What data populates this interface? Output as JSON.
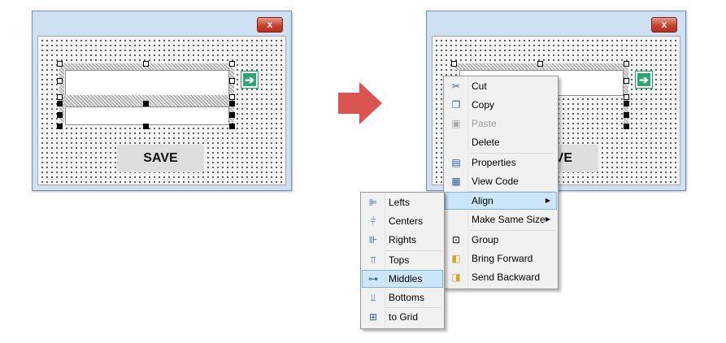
{
  "before": {
    "close_glyph": "x",
    "save_label": "SAVE"
  },
  "after": {
    "close_glyph": "x",
    "save_label_partial": "VE"
  },
  "arrow_color": "#d95550",
  "context_menu": {
    "items": [
      {
        "label": "Cut",
        "icon": "scissors-icon",
        "glyph": "✂"
      },
      {
        "label": "Copy",
        "icon": "copy-icon",
        "glyph": "❐"
      },
      {
        "label": "Paste",
        "icon": "paste-icon",
        "glyph": "▣",
        "disabled": true
      },
      {
        "label": "Delete",
        "icon": ""
      },
      {
        "label": "Properties",
        "icon": "properties-icon",
        "glyph": "▤"
      },
      {
        "label": "View Code",
        "icon": "view-code-icon",
        "glyph": "▦"
      },
      {
        "label": "Align",
        "icon": "",
        "submenu": true,
        "highlighted": true
      },
      {
        "label": "Make Same Size",
        "icon": "",
        "submenu": true
      },
      {
        "label": "Group",
        "icon": "group-icon",
        "glyph": "⊡"
      },
      {
        "label": "Bring Forward",
        "icon": "bring-forward-icon",
        "glyph": "◧"
      },
      {
        "label": "Send Backward",
        "icon": "send-backward-icon",
        "glyph": "◨"
      }
    ]
  },
  "align_submenu": {
    "items": [
      {
        "label": "Lefts",
        "icon": "align-lefts-icon",
        "glyph": "⊫"
      },
      {
        "label": "Centers",
        "icon": "align-centers-icon",
        "glyph": "⫩"
      },
      {
        "label": "Rights",
        "icon": "align-rights-icon",
        "glyph": "⊪"
      },
      {
        "label": "Tops",
        "icon": "align-tops-icon",
        "glyph": "⫪"
      },
      {
        "label": "Middles",
        "icon": "align-middles-icon",
        "glyph": "⊶",
        "highlighted": true
      },
      {
        "label": "Bottoms",
        "icon": "align-bottoms-icon",
        "glyph": "⫫"
      },
      {
        "label": "to Grid",
        "icon": "align-to-grid-icon",
        "glyph": "⊞"
      }
    ]
  }
}
